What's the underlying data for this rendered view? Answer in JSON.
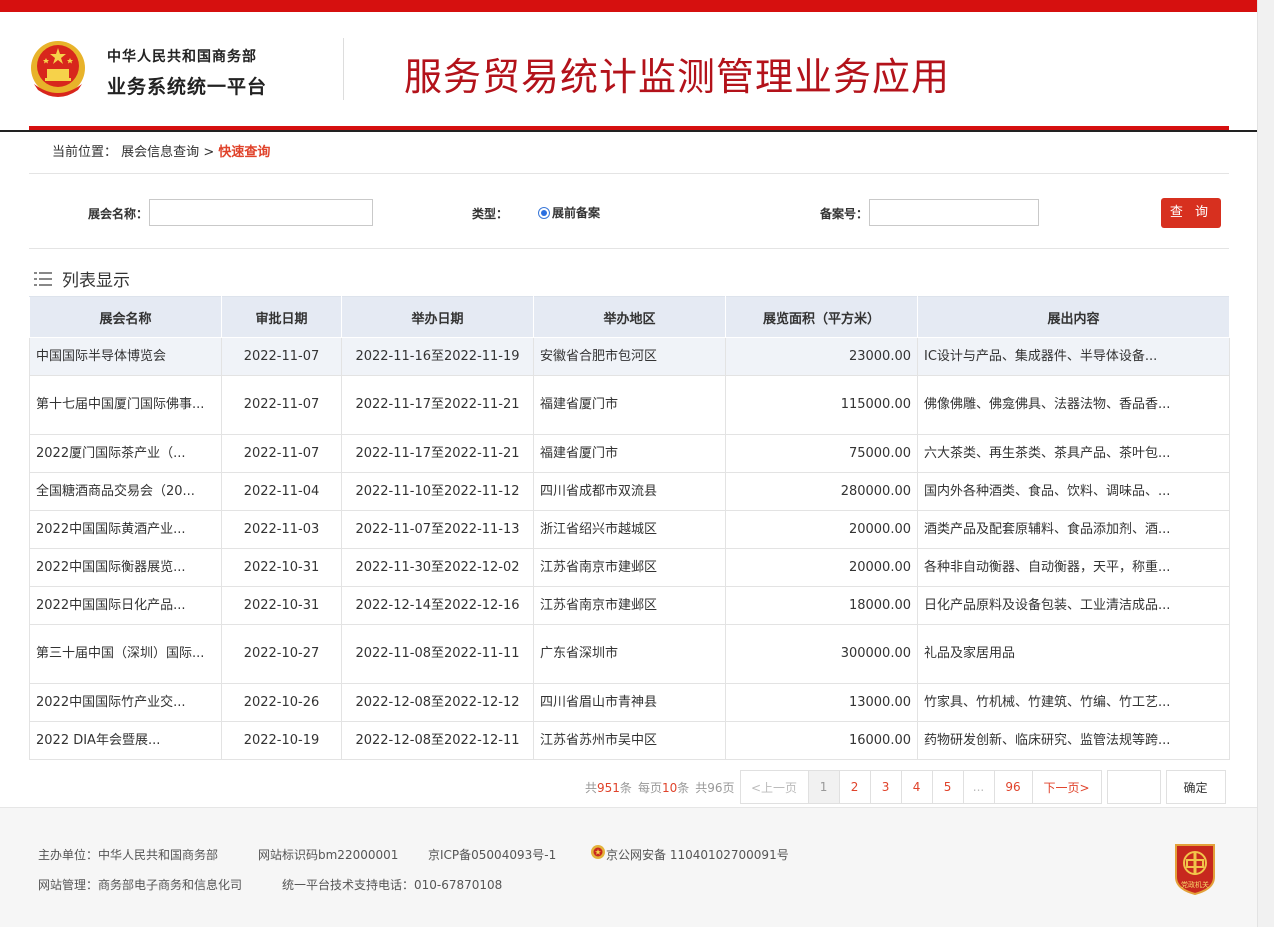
{
  "header": {
    "org_line1": "中华人民共和国商务部",
    "org_line2": "业务系统统一平台",
    "app_title": "服务贸易统计监测管理业务应用"
  },
  "breadcrumb": {
    "prefix": "当前位置：",
    "parent": "展会信息查询",
    "separator": ">",
    "current": "快速查询"
  },
  "search": {
    "name_label": "展会名称：",
    "name_value": "",
    "type_label": "类型：",
    "type_option": "展前备案",
    "record_label": "备案号：",
    "record_value": "",
    "query_button": "查 询"
  },
  "list": {
    "title": "列表显示",
    "columns": [
      "展会名称",
      "审批日期",
      "举办日期",
      "举办地区",
      "展览面积（平方米）",
      "展出内容"
    ],
    "rows": [
      {
        "name": "中国国际半导体博览会",
        "approve": "2022-11-07",
        "dates": "2022-11-16至2022-11-19",
        "region": "安徽省合肥市包河区",
        "area": "23000.00",
        "content": "IC设计与产品、集成器件、半导体设备..."
      },
      {
        "name": "第十七届中国厦门国际佛事...",
        "approve": "2022-11-07",
        "dates": "2022-11-17至2022-11-21",
        "region": "福建省厦门市",
        "area": "115000.00",
        "content": "佛像佛雕、佛龛佛具、法器法物、香品香..."
      },
      {
        "name": "2022厦门国际茶产业（...",
        "approve": "2022-11-07",
        "dates": "2022-11-17至2022-11-21",
        "region": "福建省厦门市",
        "area": "75000.00",
        "content": "六大茶类、再生茶类、茶具产品、茶叶包..."
      },
      {
        "name": "全国糖酒商品交易会（20...",
        "approve": "2022-11-04",
        "dates": "2022-11-10至2022-11-12",
        "region": "四川省成都市双流县",
        "area": "280000.00",
        "content": "国内外各种酒类、食品、饮料、调味品、..."
      },
      {
        "name": "2022中国国际黄酒产业...",
        "approve": "2022-11-03",
        "dates": "2022-11-07至2022-11-13",
        "region": "浙江省绍兴市越城区",
        "area": "20000.00",
        "content": "酒类产品及配套原辅料、食品添加剂、酒..."
      },
      {
        "name": "2022中国国际衡器展览...",
        "approve": "2022-10-31",
        "dates": "2022-11-30至2022-12-02",
        "region": "江苏省南京市建邺区",
        "area": "20000.00",
        "content": "各种非自动衡器、自动衡器，天平，称重..."
      },
      {
        "name": "2022中国国际日化产品...",
        "approve": "2022-10-31",
        "dates": "2022-12-14至2022-12-16",
        "region": "江苏省南京市建邺区",
        "area": "18000.00",
        "content": "日化产品原料及设备包装、工业清洁成品..."
      },
      {
        "name": "第三十届中国（深圳）国际...",
        "approve": "2022-10-27",
        "dates": "2022-11-08至2022-11-11",
        "region": "广东省深圳市",
        "area": "300000.00",
        "content": "礼品及家居用品"
      },
      {
        "name": "2022中国国际竹产业交...",
        "approve": "2022-10-26",
        "dates": "2022-12-08至2022-12-12",
        "region": "四川省眉山市青神县",
        "area": "13000.00",
        "content": "竹家具、竹机械、竹建筑、竹编、竹工艺..."
      },
      {
        "name": "2022 DIA年会暨展...",
        "approve": "2022-10-19",
        "dates": "2022-12-08至2022-12-11",
        "region": "江苏省苏州市吴中区",
        "area": "16000.00",
        "content": "药物研发创新、临床研究、监管法规等跨..."
      }
    ]
  },
  "pager": {
    "total_prefix": "共",
    "total": "951",
    "total_suffix": "条",
    "per_prefix": "每页",
    "per": "10",
    "per_suffix": "条",
    "pages_text": "共96页",
    "prev": "<上一页",
    "pages": [
      "1",
      "2",
      "3",
      "4",
      "5",
      "...",
      "96"
    ],
    "next": "下一页>",
    "jump_value": "",
    "confirm": "确定"
  },
  "footer": {
    "sponsor": "主办单位：中华人民共和国商务部",
    "site_id": "网站标识码bm22000001",
    "icp": "京ICP备05004093号-1",
    "police": "京公网安备 11040102700091号",
    "manager": "网站管理：商务部电子商务和信息化司",
    "support": "统一平台技术支持电话：010-67870108",
    "badge_text": "党政机关"
  },
  "colors": {
    "brand_red": "#d6100f",
    "title_red": "#b3121a",
    "link_red": "#e0432b",
    "header_bg": "#e5eaf3"
  }
}
